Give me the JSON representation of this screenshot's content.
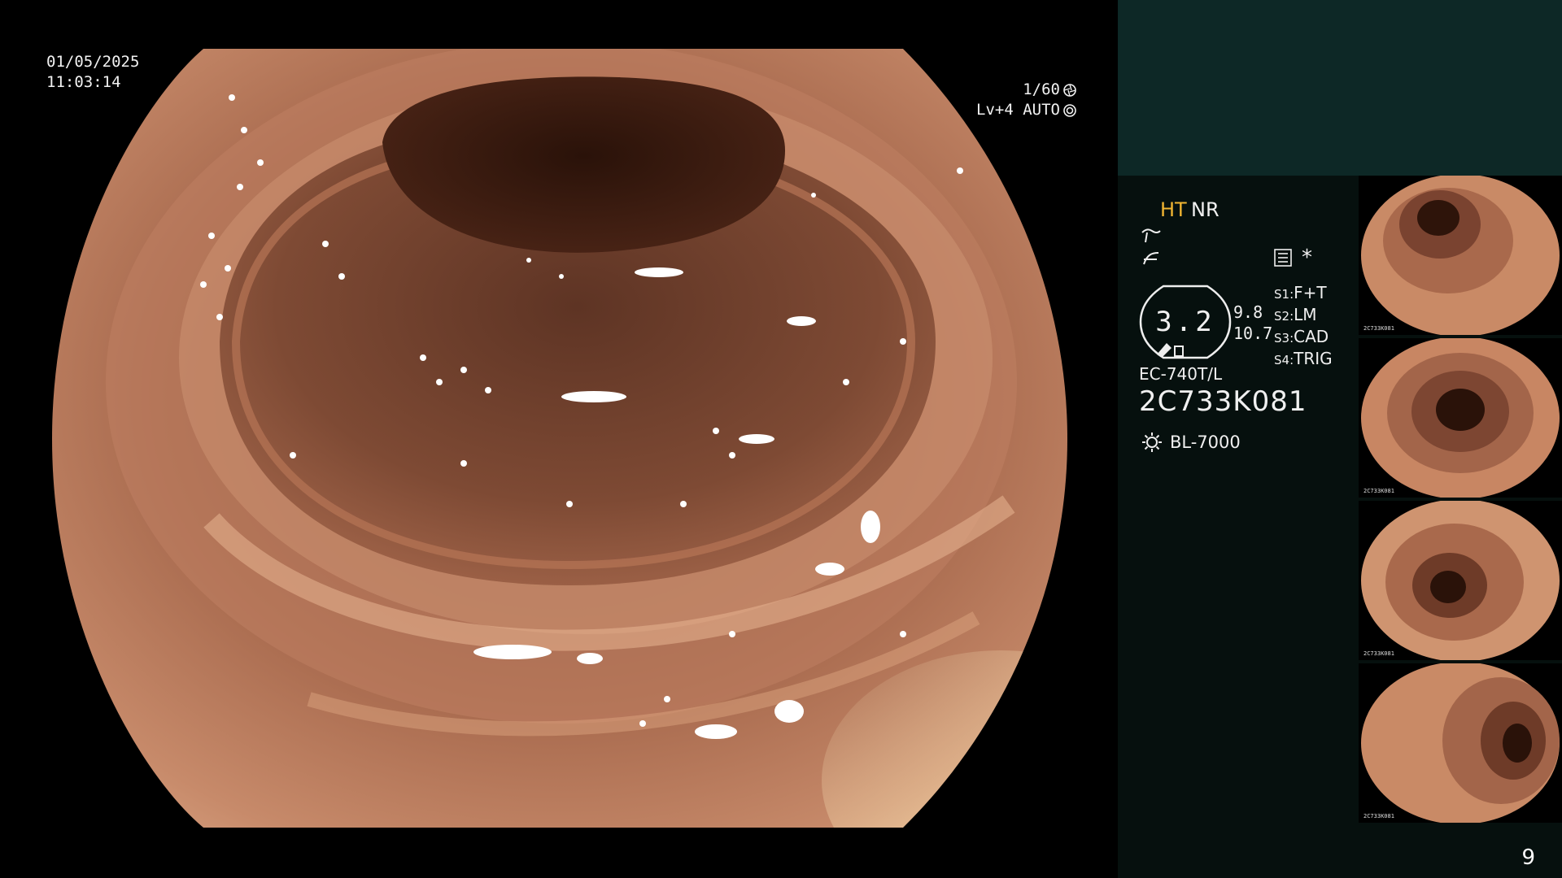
{
  "overlay": {
    "date": "01/05/2025",
    "time": "11:03:14",
    "shutter": "1/60",
    "level": "Lv+4 AUTO"
  },
  "panel": {
    "mode_ht": "HT",
    "mode_nr": "NR",
    "star": "*",
    "gauge_value": "3.2",
    "value_a": "9.8",
    "value_b": "10.7",
    "settings": [
      {
        "key": "S1:",
        "value": "F+T"
      },
      {
        "key": "S2:",
        "value": "LM"
      },
      {
        "key": "S3:",
        "value": "CAD"
      },
      {
        "key": "S4:",
        "value": "TRIG"
      }
    ],
    "scope_model": "EC-740T/L",
    "serial": "2C733K081",
    "light_source": "BL-7000"
  },
  "thumbnails": [
    {
      "caption": "2C733K081"
    },
    {
      "caption": "2C733K081"
    },
    {
      "caption": "2C733K081"
    },
    {
      "caption": "2C733K081"
    }
  ],
  "page_number": "9",
  "colors": {
    "panel_top": "#0d2826",
    "panel_body": "#06100e",
    "accent_ht": "#f2b632",
    "mucosa": "#b8775a"
  }
}
